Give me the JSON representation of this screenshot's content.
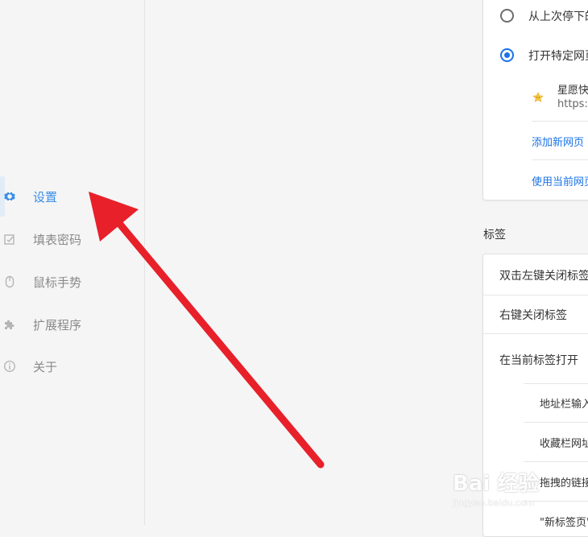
{
  "sidebar": {
    "items": [
      {
        "label": "设置",
        "icon": "gear-icon",
        "active": true
      },
      {
        "label": "填表密码",
        "icon": "form-check-icon",
        "active": false
      },
      {
        "label": "鼠标手势",
        "icon": "mouse-icon",
        "active": false
      },
      {
        "label": "扩展程序",
        "icon": "puzzle-icon",
        "active": false
      },
      {
        "label": "关于",
        "icon": "info-icon",
        "active": false
      }
    ]
  },
  "startup": {
    "option_resume": "从上次停下的",
    "option_specific": "打开特定网页",
    "page_name": "星愿快",
    "page_url": "https://",
    "add_page_link": "添加新网页",
    "use_current_link": "使用当前网页"
  },
  "tabs_section": {
    "title": "标签",
    "rows": [
      "双击左键关闭标签",
      "右键关闭标签",
      "在当前标签打开"
    ],
    "subrows": [
      "地址栏输入",
      "收藏栏网址",
      "拖拽的链接",
      "\"新标签页\""
    ]
  },
  "watermark": {
    "main": "Bai 经验",
    "sub": "jingyan.baidu.com"
  },
  "colors": {
    "accent": "#1a73e8",
    "sidebar_active": "#3a8ee6",
    "arrow": "#e8202a"
  }
}
